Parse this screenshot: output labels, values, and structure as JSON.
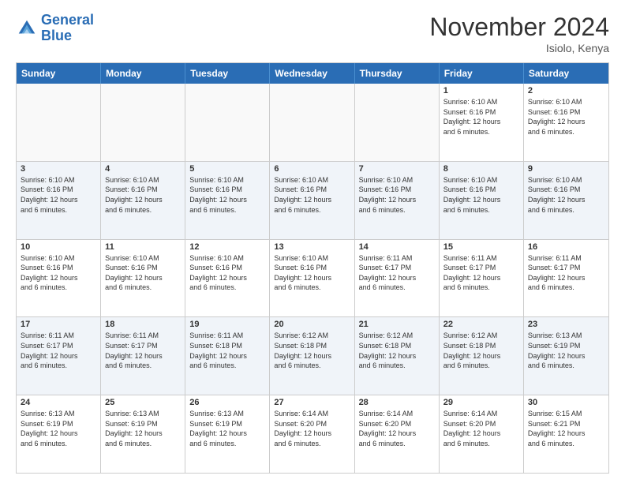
{
  "logo": {
    "line1": "General",
    "line2": "Blue"
  },
  "title": "November 2024",
  "location": "Isiolo, Kenya",
  "header_days": [
    "Sunday",
    "Monday",
    "Tuesday",
    "Wednesday",
    "Thursday",
    "Friday",
    "Saturday"
  ],
  "rows": [
    {
      "alt": false,
      "cells": [
        {
          "day": "",
          "info": "",
          "empty": true
        },
        {
          "day": "",
          "info": "",
          "empty": true
        },
        {
          "day": "",
          "info": "",
          "empty": true
        },
        {
          "day": "",
          "info": "",
          "empty": true
        },
        {
          "day": "",
          "info": "",
          "empty": true
        },
        {
          "day": "1",
          "info": "Sunrise: 6:10 AM\nSunset: 6:16 PM\nDaylight: 12 hours\nand 6 minutes.",
          "empty": false
        },
        {
          "day": "2",
          "info": "Sunrise: 6:10 AM\nSunset: 6:16 PM\nDaylight: 12 hours\nand 6 minutes.",
          "empty": false
        }
      ]
    },
    {
      "alt": true,
      "cells": [
        {
          "day": "3",
          "info": "Sunrise: 6:10 AM\nSunset: 6:16 PM\nDaylight: 12 hours\nand 6 minutes.",
          "empty": false
        },
        {
          "day": "4",
          "info": "Sunrise: 6:10 AM\nSunset: 6:16 PM\nDaylight: 12 hours\nand 6 minutes.",
          "empty": false
        },
        {
          "day": "5",
          "info": "Sunrise: 6:10 AM\nSunset: 6:16 PM\nDaylight: 12 hours\nand 6 minutes.",
          "empty": false
        },
        {
          "day": "6",
          "info": "Sunrise: 6:10 AM\nSunset: 6:16 PM\nDaylight: 12 hours\nand 6 minutes.",
          "empty": false
        },
        {
          "day": "7",
          "info": "Sunrise: 6:10 AM\nSunset: 6:16 PM\nDaylight: 12 hours\nand 6 minutes.",
          "empty": false
        },
        {
          "day": "8",
          "info": "Sunrise: 6:10 AM\nSunset: 6:16 PM\nDaylight: 12 hours\nand 6 minutes.",
          "empty": false
        },
        {
          "day": "9",
          "info": "Sunrise: 6:10 AM\nSunset: 6:16 PM\nDaylight: 12 hours\nand 6 minutes.",
          "empty": false
        }
      ]
    },
    {
      "alt": false,
      "cells": [
        {
          "day": "10",
          "info": "Sunrise: 6:10 AM\nSunset: 6:16 PM\nDaylight: 12 hours\nand 6 minutes.",
          "empty": false
        },
        {
          "day": "11",
          "info": "Sunrise: 6:10 AM\nSunset: 6:16 PM\nDaylight: 12 hours\nand 6 minutes.",
          "empty": false
        },
        {
          "day": "12",
          "info": "Sunrise: 6:10 AM\nSunset: 6:16 PM\nDaylight: 12 hours\nand 6 minutes.",
          "empty": false
        },
        {
          "day": "13",
          "info": "Sunrise: 6:10 AM\nSunset: 6:16 PM\nDaylight: 12 hours\nand 6 minutes.",
          "empty": false
        },
        {
          "day": "14",
          "info": "Sunrise: 6:11 AM\nSunset: 6:17 PM\nDaylight: 12 hours\nand 6 minutes.",
          "empty": false
        },
        {
          "day": "15",
          "info": "Sunrise: 6:11 AM\nSunset: 6:17 PM\nDaylight: 12 hours\nand 6 minutes.",
          "empty": false
        },
        {
          "day": "16",
          "info": "Sunrise: 6:11 AM\nSunset: 6:17 PM\nDaylight: 12 hours\nand 6 minutes.",
          "empty": false
        }
      ]
    },
    {
      "alt": true,
      "cells": [
        {
          "day": "17",
          "info": "Sunrise: 6:11 AM\nSunset: 6:17 PM\nDaylight: 12 hours\nand 6 minutes.",
          "empty": false
        },
        {
          "day": "18",
          "info": "Sunrise: 6:11 AM\nSunset: 6:17 PM\nDaylight: 12 hours\nand 6 minutes.",
          "empty": false
        },
        {
          "day": "19",
          "info": "Sunrise: 6:11 AM\nSunset: 6:18 PM\nDaylight: 12 hours\nand 6 minutes.",
          "empty": false
        },
        {
          "day": "20",
          "info": "Sunrise: 6:12 AM\nSunset: 6:18 PM\nDaylight: 12 hours\nand 6 minutes.",
          "empty": false
        },
        {
          "day": "21",
          "info": "Sunrise: 6:12 AM\nSunset: 6:18 PM\nDaylight: 12 hours\nand 6 minutes.",
          "empty": false
        },
        {
          "day": "22",
          "info": "Sunrise: 6:12 AM\nSunset: 6:18 PM\nDaylight: 12 hours\nand 6 minutes.",
          "empty": false
        },
        {
          "day": "23",
          "info": "Sunrise: 6:13 AM\nSunset: 6:19 PM\nDaylight: 12 hours\nand 6 minutes.",
          "empty": false
        }
      ]
    },
    {
      "alt": false,
      "cells": [
        {
          "day": "24",
          "info": "Sunrise: 6:13 AM\nSunset: 6:19 PM\nDaylight: 12 hours\nand 6 minutes.",
          "empty": false
        },
        {
          "day": "25",
          "info": "Sunrise: 6:13 AM\nSunset: 6:19 PM\nDaylight: 12 hours\nand 6 minutes.",
          "empty": false
        },
        {
          "day": "26",
          "info": "Sunrise: 6:13 AM\nSunset: 6:19 PM\nDaylight: 12 hours\nand 6 minutes.",
          "empty": false
        },
        {
          "day": "27",
          "info": "Sunrise: 6:14 AM\nSunset: 6:20 PM\nDaylight: 12 hours\nand 6 minutes.",
          "empty": false
        },
        {
          "day": "28",
          "info": "Sunrise: 6:14 AM\nSunset: 6:20 PM\nDaylight: 12 hours\nand 6 minutes.",
          "empty": false
        },
        {
          "day": "29",
          "info": "Sunrise: 6:14 AM\nSunset: 6:20 PM\nDaylight: 12 hours\nand 6 minutes.",
          "empty": false
        },
        {
          "day": "30",
          "info": "Sunrise: 6:15 AM\nSunset: 6:21 PM\nDaylight: 12 hours\nand 6 minutes.",
          "empty": false
        }
      ]
    }
  ]
}
